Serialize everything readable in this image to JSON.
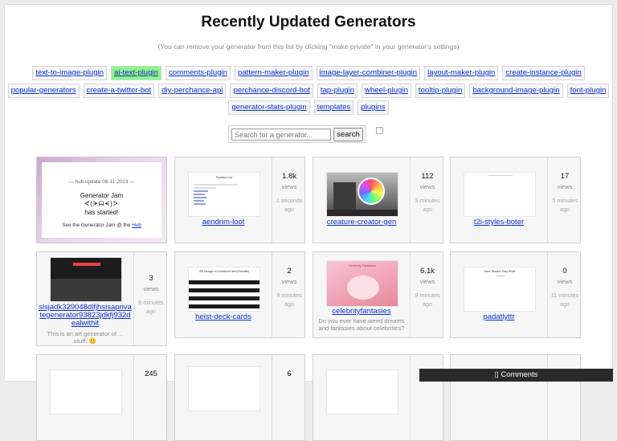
{
  "header": {
    "title": "Recently Updated Generators",
    "subtitle": "(You can remove your generator from this list by clicking \"make private\" in your generator's settings)"
  },
  "tags_row1": [
    "text-to-image-plugin",
    "ai-text-plugin",
    "comments-plugin",
    "pattern-maker-plugin",
    "image-layer-combiner-plugin",
    "layout-maker-plugin",
    "create-instance-plugin"
  ],
  "tags_row2": [
    "popular-generators",
    "create-a-twitter-bot",
    "diy-perchance-api",
    "perchance-discord-bot",
    "tap-plugin",
    "wheel-plugin",
    "tooltip-plugin",
    "background-image-plugin",
    "font-plugin"
  ],
  "tags_row3": [
    "generator-stats-plugin",
    "templates",
    "plugins"
  ],
  "active_tag": "ai-text-plugin",
  "search": {
    "placeholder": "Search for a generator...",
    "button": "search"
  },
  "promo": {
    "line1": "— hub update 06-11-2023 —",
    "line2": "Generator Jam",
    "line3": "ᕙ(ᗒᗣᗕ)ᕗ",
    "line4": "has started!",
    "line5_prefix": "See the Generator Jam @ the ",
    "line5_link": "Hub"
  },
  "cards": [
    {
      "name": "aendrim-loot",
      "count": "1.8k",
      "views": "views",
      "ago": "2 seconds ago",
      "thumb_title": "Fantasy Loot"
    },
    {
      "name": "creature-creator-gen",
      "count": "112",
      "views": "views",
      "ago": "3 minutes ago"
    },
    {
      "name": "t2i-styles-boter",
      "count": "17",
      "views": "views",
      "ago": "5 minutes ago"
    },
    {
      "name": "slsjadk329048dlfjhsisaprivategenerator93823jdkfj932dealwithit",
      "desc": "This is an art generator of ... stuff. 🙂",
      "count": "3",
      "views": "views",
      "ago": "6 minutes ago"
    },
    {
      "name": "heist-deck-cards",
      "count": "2",
      "views": "views",
      "ago": "8 minutes ago",
      "thumb_title": "Gift Stronger in Confidence Heist (Printable)"
    },
    {
      "name": "celebrityfantasies",
      "desc": "Do you ever have weird dreams and fantasies about celebrities?",
      "count": "6.1k",
      "views": "views",
      "ago": "9 minutes ago",
      "thumb_title": "Celebrity Fantasies"
    },
    {
      "name": "padatlyttr",
      "count": "0",
      "views": "views",
      "ago": "11 minutes ago",
      "thumb_title": "Some Random Story Writer"
    },
    {
      "name": "",
      "count": "245",
      "views": "",
      "ago": ""
    },
    {
      "name": "",
      "count": "",
      "views": "",
      "ago": ""
    },
    {
      "name": "",
      "count": "6",
      "views": "",
      "ago": ""
    },
    {
      "name": "",
      "count": "",
      "views": "",
      "ago": ""
    }
  ],
  "comments": {
    "label": "Comments"
  },
  "colors": {
    "active_tag": "#8ff28f",
    "link": "#0a2fd6",
    "comments_bar": "#2a2a2a"
  }
}
